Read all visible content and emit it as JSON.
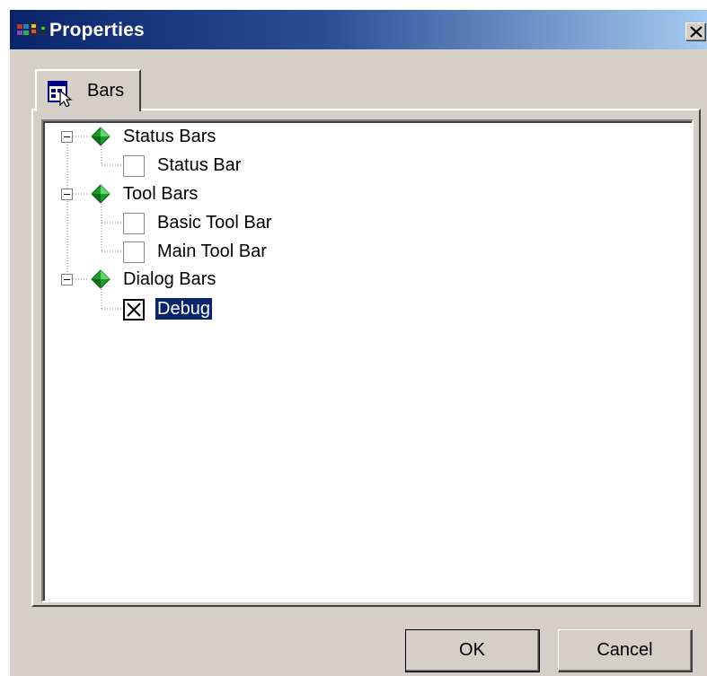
{
  "window": {
    "title": "Properties",
    "icon": "properties-app-icon",
    "close_icon": "close-icon"
  },
  "tabs": [
    {
      "label": "Bars",
      "icon": "bars-tab-icon",
      "active": true
    }
  ],
  "tree": {
    "groups": [
      {
        "label": "Status Bars",
        "expanded": true,
        "icon": "green-gem-icon",
        "items": [
          {
            "label": "Status Bar",
            "checked": false
          }
        ]
      },
      {
        "label": "Tool Bars",
        "expanded": true,
        "icon": "green-gem-icon",
        "items": [
          {
            "label": "Basic Tool Bar",
            "checked": false
          },
          {
            "label": "Main Tool Bar",
            "checked": false
          }
        ]
      },
      {
        "label": "Dialog Bars",
        "expanded": true,
        "icon": "green-gem-icon",
        "items": [
          {
            "label": "Debug",
            "checked": true,
            "selected": true
          }
        ]
      }
    ]
  },
  "buttons": {
    "ok_label": "OK",
    "cancel_label": "Cancel"
  },
  "colors": {
    "title_gradient_start": "#0a246a",
    "title_gradient_end": "#a6caf0",
    "selection": "#0a246a",
    "dialog_face": "#d4d0c8",
    "gem_green": "#1e9b2a"
  }
}
